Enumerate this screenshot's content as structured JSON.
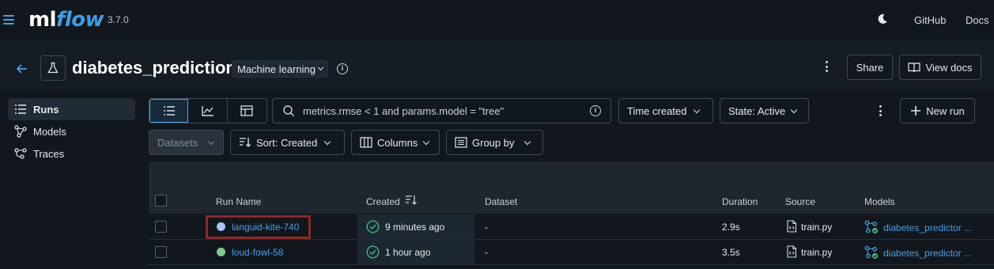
{
  "app": {
    "logo_ml": "ml",
    "logo_flow": "flow",
    "version": "3.7.0"
  },
  "topnav": {
    "github": "GitHub",
    "docs": "Docs"
  },
  "experiment": {
    "title": "diabetes_prediction",
    "tag": "Machine learning",
    "share_label": "Share",
    "view_docs_label": "View docs"
  },
  "sidebar": {
    "items": [
      {
        "label": "Runs",
        "icon": "list-icon",
        "active": true
      },
      {
        "label": "Models",
        "icon": "models-icon",
        "active": false
      },
      {
        "label": "Traces",
        "icon": "traces-icon",
        "active": false
      }
    ]
  },
  "toolbar": {
    "search_value": "metrics.rmse < 1 and params.model = \"tree\"",
    "time_created": "Time created",
    "state": "State: Active",
    "new_run": "New run",
    "datasets": "Datasets",
    "sort": "Sort: Created",
    "columns": "Columns",
    "group_by": "Group by"
  },
  "table": {
    "headers": {
      "run_name": "Run Name",
      "created": "Created",
      "dataset": "Dataset",
      "duration": "Duration",
      "source": "Source",
      "models": "Models"
    },
    "rows": [
      {
        "run_name": "languid-kite-740",
        "dot_color": "#a9c4f5",
        "created": "9 minutes ago",
        "dataset": "-",
        "duration": "2.9s",
        "source": "train.py",
        "model": "diabetes_predictor ..."
      },
      {
        "run_name": "loud-fowl-58",
        "dot_color": "#7ec98a",
        "created": "1 hour ago",
        "dataset": "-",
        "duration": "3.5s",
        "source": "train.py",
        "model": "diabetes_predictor ..."
      }
    ]
  },
  "colors": {
    "accent": "#4a9fe6",
    "background": "#11171c",
    "highlight": "#8b2a28",
    "success": "#3fb67a"
  }
}
